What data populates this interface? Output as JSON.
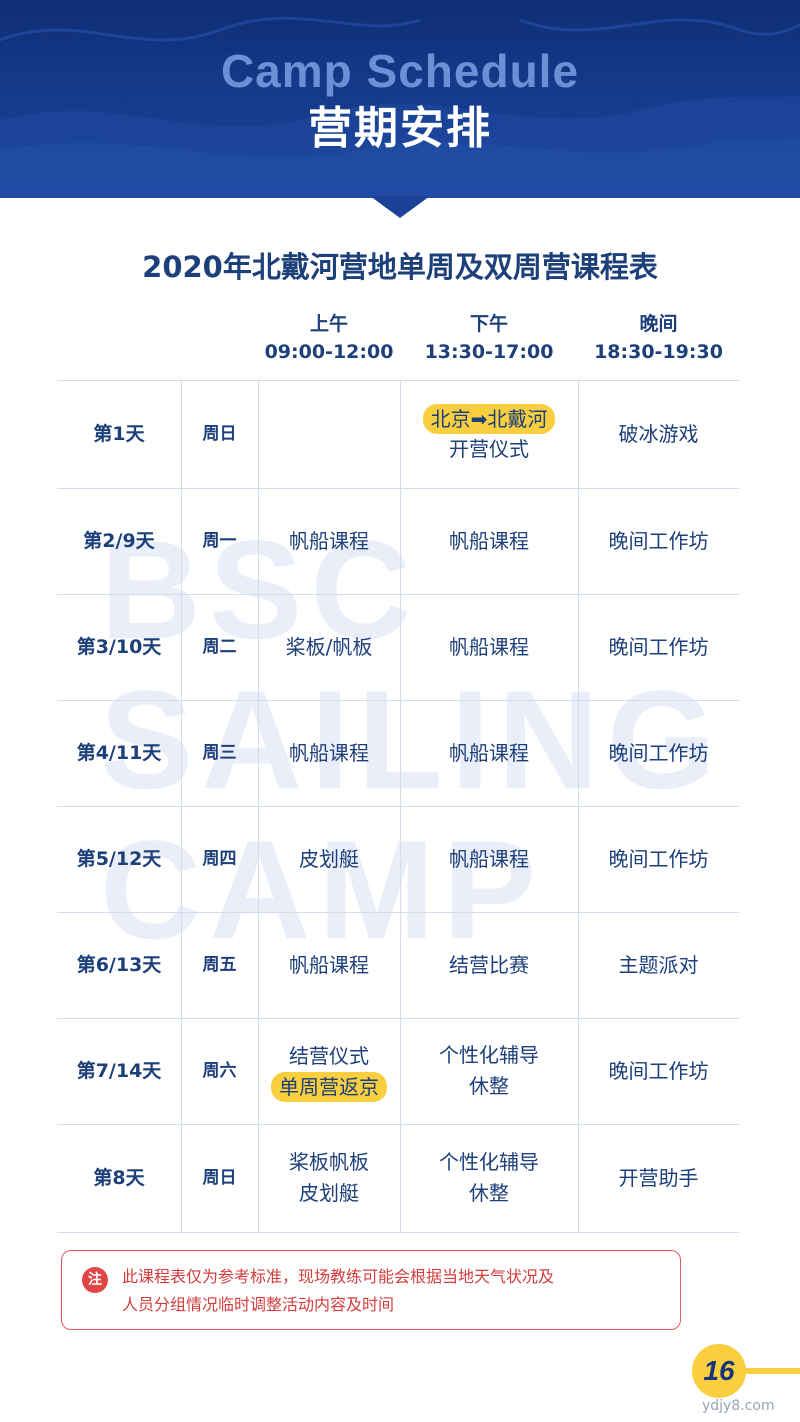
{
  "header": {
    "title_en": "Camp Schedule",
    "title_cn": "营期安排"
  },
  "table_title": "2020年北戴河营地单周及双周营课程表",
  "watermark": [
    "BSC",
    "SAILING",
    "CAMP"
  ],
  "columns": [
    {
      "label": "上午",
      "time": "09:00-12:00"
    },
    {
      "label": "下午",
      "time": "13:30-17:00"
    },
    {
      "label": "晚间",
      "time": "18:30-19:30"
    }
  ],
  "rows": [
    {
      "day": "第1天",
      "weekday": "周日",
      "morning": [],
      "afternoon": [
        {
          "text": "北京➡北戴河",
          "hl": true
        },
        {
          "text": "开营仪式",
          "hl": false
        }
      ],
      "evening": [
        {
          "text": "破冰游戏",
          "hl": false
        }
      ]
    },
    {
      "day": "第2/9天",
      "weekday": "周一",
      "morning": [
        {
          "text": "帆船课程",
          "hl": false
        }
      ],
      "afternoon": [
        {
          "text": "帆船课程",
          "hl": false
        }
      ],
      "evening": [
        {
          "text": "晚间工作坊",
          "hl": false
        }
      ]
    },
    {
      "day": "第3/10天",
      "weekday": "周二",
      "morning": [
        {
          "text": "桨板/帆板",
          "hl": false
        }
      ],
      "afternoon": [
        {
          "text": "帆船课程",
          "hl": false
        }
      ],
      "evening": [
        {
          "text": "晚间工作坊",
          "hl": false
        }
      ]
    },
    {
      "day": "第4/11天",
      "weekday": "周三",
      "morning": [
        {
          "text": "帆船课程",
          "hl": false
        }
      ],
      "afternoon": [
        {
          "text": "帆船课程",
          "hl": false
        }
      ],
      "evening": [
        {
          "text": "晚间工作坊",
          "hl": false
        }
      ]
    },
    {
      "day": "第5/12天",
      "weekday": "周四",
      "morning": [
        {
          "text": "皮划艇",
          "hl": false
        }
      ],
      "afternoon": [
        {
          "text": "帆船课程",
          "hl": false
        }
      ],
      "evening": [
        {
          "text": "晚间工作坊",
          "hl": false
        }
      ]
    },
    {
      "day": "第6/13天",
      "weekday": "周五",
      "morning": [
        {
          "text": "帆船课程",
          "hl": false
        }
      ],
      "afternoon": [
        {
          "text": "结营比赛",
          "hl": false
        }
      ],
      "evening": [
        {
          "text": "主题派对",
          "hl": false
        }
      ]
    },
    {
      "day": "第7/14天",
      "weekday": "周六",
      "morning": [
        {
          "text": "结营仪式",
          "hl": false
        },
        {
          "text": "单周营返京",
          "hl": true
        }
      ],
      "afternoon": [
        {
          "text": "个性化辅导",
          "hl": false
        },
        {
          "text": "休整",
          "hl": false
        }
      ],
      "evening": [
        {
          "text": "晚间工作坊",
          "hl": false
        }
      ]
    },
    {
      "day": "第8天",
      "weekday": "周日",
      "morning": [
        {
          "text": "桨板帆板",
          "hl": false
        },
        {
          "text": "皮划艇",
          "hl": false
        }
      ],
      "afternoon": [
        {
          "text": "个性化辅导",
          "hl": false
        },
        {
          "text": "休整",
          "hl": false
        }
      ],
      "evening": [
        {
          "text": "开营助手",
          "hl": false
        }
      ]
    }
  ],
  "note": {
    "badge": "注",
    "line1": "此课程表仅为参考标准，现场教练可能会根据当地天气状况及",
    "line2": "人员分组情况临时调整活动内容及时间"
  },
  "page_number": "16",
  "site": "ydjy8.com",
  "colors": {
    "navy": "#1d3f7a",
    "banner": "#163a8a",
    "highlight": "#f9cf3f",
    "note_red": "#d23d3d"
  }
}
